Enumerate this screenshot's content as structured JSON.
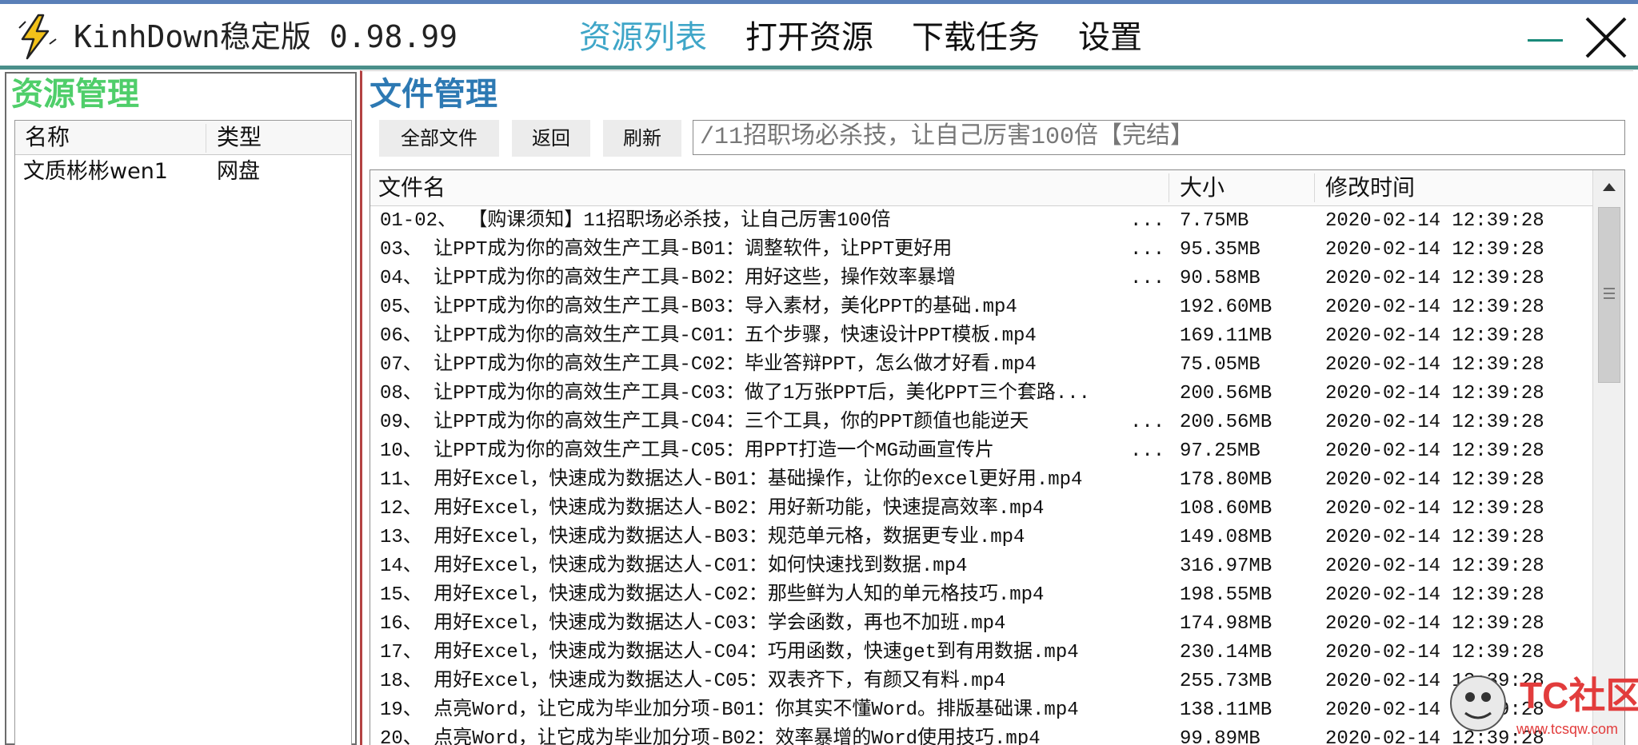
{
  "window": {
    "app_title": "KinhDown稳定版 0.98.99",
    "nav": [
      {
        "label": "资源列表",
        "active": true
      },
      {
        "label": "打开资源",
        "active": false
      },
      {
        "label": "下载任务",
        "active": false
      },
      {
        "label": "设置",
        "active": false
      }
    ],
    "accent_color": "#3fa6c8"
  },
  "resource_panel": {
    "title": "资源管理",
    "title_color": "#4fce6a",
    "columns": [
      "名称",
      "类型"
    ],
    "rows": [
      {
        "name": "文质彬彬wen1",
        "type": "网盘"
      }
    ]
  },
  "file_panel": {
    "title": "文件管理",
    "title_color": "#2d79b3",
    "buttons": {
      "all_files": "全部文件",
      "back": "返回",
      "refresh": "刷新"
    },
    "path": "/11招职场必杀技，让自己厉害100倍【完结】",
    "columns": {
      "name": "文件名",
      "size": "大小",
      "modified": "修改时间"
    },
    "files": [
      {
        "name": "01-02、 【购课须知】11招职场必杀技，让自己厉害100倍",
        "dots": "...",
        "size": "7.75MB",
        "time": "2020-02-14 12:39:28"
      },
      {
        "name": "03、 让PPT成为你的高效生产工具-B01：调整软件，让PPT更好用",
        "dots": "...",
        "size": "95.35MB",
        "time": "2020-02-14 12:39:28"
      },
      {
        "name": "04、 让PPT成为你的高效生产工具-B02：用好这些，操作效率暴增",
        "dots": "...",
        "size": "90.58MB",
        "time": "2020-02-14 12:39:28"
      },
      {
        "name": "05、 让PPT成为你的高效生产工具-B03：导入素材，美化PPT的基础.mp4",
        "dots": "",
        "size": "192.60MB",
        "time": "2020-02-14 12:39:28"
      },
      {
        "name": "06、 让PPT成为你的高效生产工具-C01：五个步骤，快速设计PPT模板.mp4",
        "dots": "",
        "size": "169.11MB",
        "time": "2020-02-14 12:39:28"
      },
      {
        "name": "07、 让PPT成为你的高效生产工具-C02：毕业答辩PPT，怎么做才好看.mp4",
        "dots": "",
        "size": "75.05MB",
        "time": "2020-02-14 12:39:28"
      },
      {
        "name": "08、 让PPT成为你的高效生产工具-C03：做了1万张PPT后，美化PPT三个套路...",
        "dots": "",
        "size": "200.56MB",
        "time": "2020-02-14 12:39:28"
      },
      {
        "name": "09、 让PPT成为你的高效生产工具-C04：三个工具，你的PPT颜值也能逆天",
        "dots": "...",
        "size": "200.56MB",
        "time": "2020-02-14 12:39:28"
      },
      {
        "name": "10、 让PPT成为你的高效生产工具-C05：用PPT打造一个MG动画宣传片",
        "dots": "...",
        "size": "97.25MB",
        "time": "2020-02-14 12:39:28"
      },
      {
        "name": "11、 用好Excel，快速成为数据达人-B01：基础操作，让你的excel更好用.mp4",
        "dots": "",
        "size": "178.80MB",
        "time": "2020-02-14 12:39:28"
      },
      {
        "name": "12、 用好Excel，快速成为数据达人-B02：用好新功能，快速提高效率.mp4",
        "dots": "",
        "size": "108.60MB",
        "time": "2020-02-14 12:39:28"
      },
      {
        "name": "13、 用好Excel，快速成为数据达人-B03：规范单元格，数据更专业.mp4",
        "dots": "",
        "size": "149.08MB",
        "time": "2020-02-14 12:39:28"
      },
      {
        "name": "14、 用好Excel，快速成为数据达人-C01：如何快速找到数据.mp4",
        "dots": "",
        "size": "316.97MB",
        "time": "2020-02-14 12:39:28"
      },
      {
        "name": "15、 用好Excel，快速成为数据达人-C02：那些鲜为人知的单元格技巧.mp4",
        "dots": "",
        "size": "198.55MB",
        "time": "2020-02-14 12:39:28"
      },
      {
        "name": "16、 用好Excel，快速成为数据达人-C03：学会函数，再也不加班.mp4",
        "dots": "",
        "size": "174.98MB",
        "time": "2020-02-14 12:39:28"
      },
      {
        "name": "17、 用好Excel，快速成为数据达人-C04：巧用函数，快速get到有用数据.mp4",
        "dots": "",
        "size": "230.14MB",
        "time": "2020-02-14 12:39:28"
      },
      {
        "name": "18、 用好Excel，快速成为数据达人-C05：双表齐下，有颜又有料.mp4",
        "dots": "",
        "size": "255.73MB",
        "time": "2020-02-14 12:39:28"
      },
      {
        "name": "19、 点亮Word，让它成为毕业加分项-B01：你其实不懂Word。排版基础课.mp4",
        "dots": "",
        "size": "138.11MB",
        "time": "2020-02-14 12:39:28"
      },
      {
        "name": "20、 点亮Word，让它成为毕业加分项-B02：效率暴增的Word使用技巧.mp4",
        "dots": "",
        "size": "99.89MB",
        "time": "2020-02-14 12:39:28"
      }
    ]
  },
  "watermark": {
    "text": "TC社区",
    "url": "www.tcsqw.com"
  }
}
